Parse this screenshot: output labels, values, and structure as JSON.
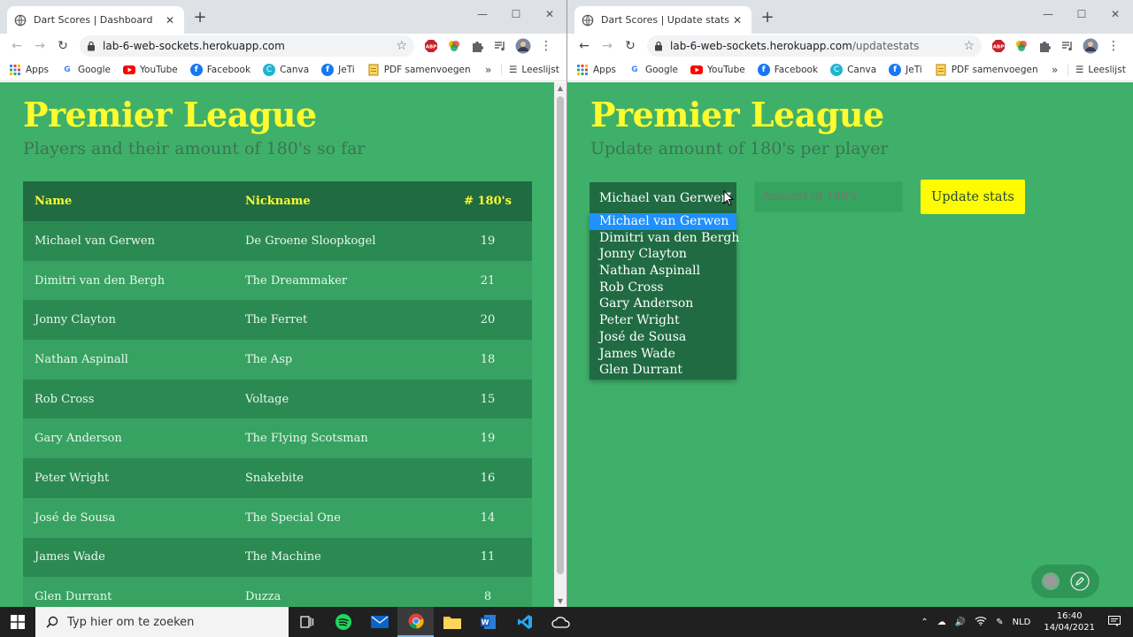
{
  "left": {
    "tab_title": "Dart Scores | Dashboard",
    "url_host": "lab-6-web-sockets.herokuapp.com",
    "url_path": "",
    "title": "Premier League",
    "subtitle": "Players and their amount of 180's so far",
    "table": {
      "headers": [
        "Name",
        "Nickname",
        "# 180's"
      ],
      "rows": [
        [
          "Michael van Gerwen",
          "De Groene Sloopkogel",
          "19"
        ],
        [
          "Dimitri van den Bergh",
          "The Dreammaker",
          "21"
        ],
        [
          "Jonny Clayton",
          "The Ferret",
          "20"
        ],
        [
          "Nathan Aspinall",
          "The Asp",
          "18"
        ],
        [
          "Rob Cross",
          "Voltage",
          "15"
        ],
        [
          "Gary Anderson",
          "The Flying Scotsman",
          "19"
        ],
        [
          "Peter Wright",
          "Snakebite",
          "16"
        ],
        [
          "José de Sousa",
          "The Special One",
          "14"
        ],
        [
          "James Wade",
          "The Machine",
          "11"
        ],
        [
          "Glen Durrant",
          "Duzza",
          "8"
        ]
      ]
    }
  },
  "right": {
    "tab_title": "Dart Scores | Update stats",
    "url_host": "lab-6-web-sockets.herokuapp.com",
    "url_path": "/updatestats",
    "title": "Premier League",
    "subtitle": "Update amount of 180's per player",
    "select_value": "Michael van Gerwen",
    "amount_placeholder": "Amount of 180's",
    "button_label": "Update stats",
    "options": [
      "Michael van Gerwen",
      "Dimitri van den Bergh",
      "Jonny Clayton",
      "Nathan Aspinall",
      "Rob Cross",
      "Gary Anderson",
      "Peter Wright",
      "José de Sousa",
      "James Wade",
      "Glen Durrant"
    ]
  },
  "bookmarks": [
    "Apps",
    "Google",
    "YouTube",
    "Facebook",
    "Canva",
    "JeTi",
    "PDF samenvoegen"
  ],
  "reading_list": "Leeslijst",
  "more_bookmarks": "»",
  "taskbar": {
    "search_placeholder": "Typ hier om te zoeken",
    "language": "NLD",
    "time": "16:40",
    "date": "14/04/2021"
  },
  "colors": {
    "page_bg": "#3fb06a",
    "title": "#fffb2e",
    "table_header": "#206b42",
    "button": "#fffb00"
  }
}
